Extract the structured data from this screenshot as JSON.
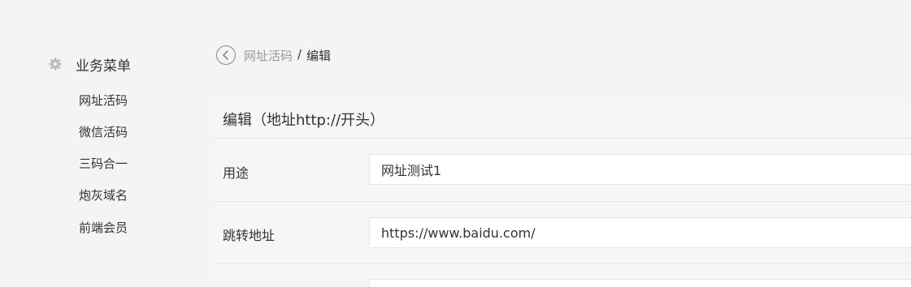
{
  "sidebar": {
    "title": "业务菜单",
    "title_icon": "gear-icon",
    "items": [
      {
        "label": "网址活码"
      },
      {
        "label": "微信活码"
      },
      {
        "label": "三码合一"
      },
      {
        "label": "炮灰域名"
      },
      {
        "label": "前端会员"
      }
    ]
  },
  "breadcrumb": {
    "back_icon": "chevron-left-icon",
    "parent": "网址活码",
    "separator": "/",
    "current": "编辑"
  },
  "form": {
    "title": "编辑（地址http://开头）",
    "fields": [
      {
        "label": "用途",
        "value": "网址测试1"
      },
      {
        "label": "跳转地址",
        "value": "https://www.baidu.com/"
      }
    ]
  },
  "colors": {
    "background": "#f4f4f4",
    "text": "#333333",
    "muted": "#999999",
    "border": "#e6e6e6"
  }
}
